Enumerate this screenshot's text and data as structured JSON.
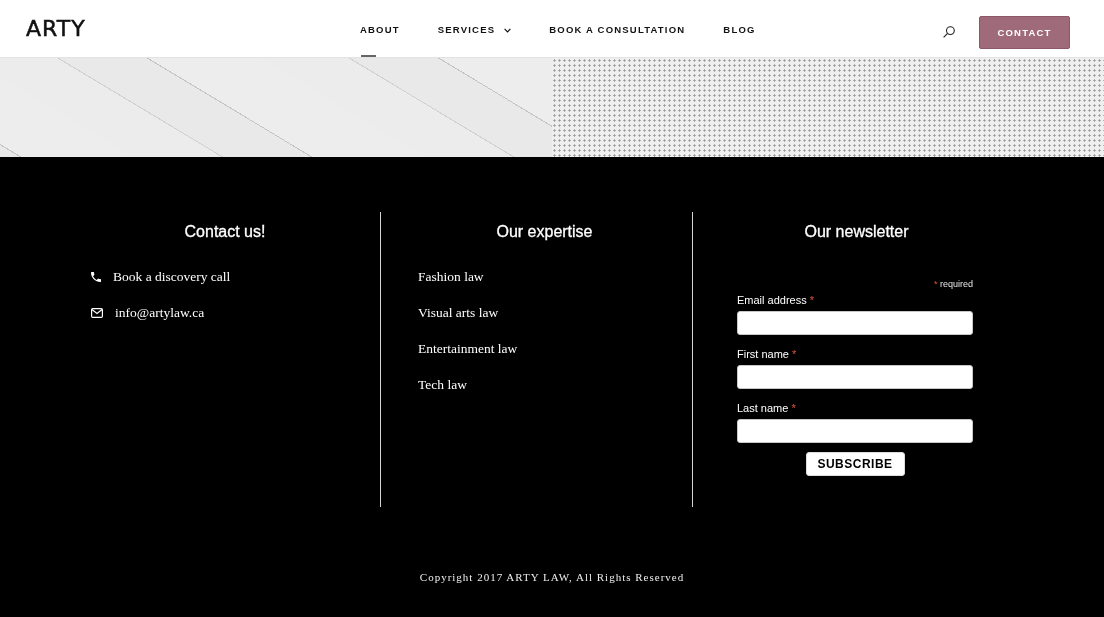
{
  "header": {
    "logo": "ARTY",
    "nav": [
      {
        "label": "ABOUT",
        "selected": true,
        "dropdown": false
      },
      {
        "label": "SERVICES",
        "selected": false,
        "dropdown": true
      },
      {
        "label": "BOOK A CONSULTATION",
        "selected": false,
        "dropdown": false
      },
      {
        "label": "BLOG",
        "selected": false,
        "dropdown": false
      }
    ],
    "contact_button": "CONTACT"
  },
  "footer": {
    "contact": {
      "title": "Contact us!",
      "items": [
        {
          "kind": "phone",
          "label": "Book a discovery call"
        },
        {
          "kind": "email",
          "label": "info@artylaw.ca"
        }
      ]
    },
    "expertise": {
      "title": "Our expertise",
      "items": [
        "Fashion law",
        "Visual arts law",
        "Entertainment law",
        "Tech law"
      ]
    },
    "newsletter": {
      "title": "Our newsletter",
      "required_mark": "*",
      "required_note": "required",
      "fields": [
        {
          "label": "Email address",
          "required": true
        },
        {
          "label": "First name",
          "required": true
        },
        {
          "label": "Last name",
          "required": true
        }
      ],
      "button": "SUBSCRIBE"
    },
    "copyright": "Copyright 2017 ARTY LAW, All Rights Reserved"
  }
}
